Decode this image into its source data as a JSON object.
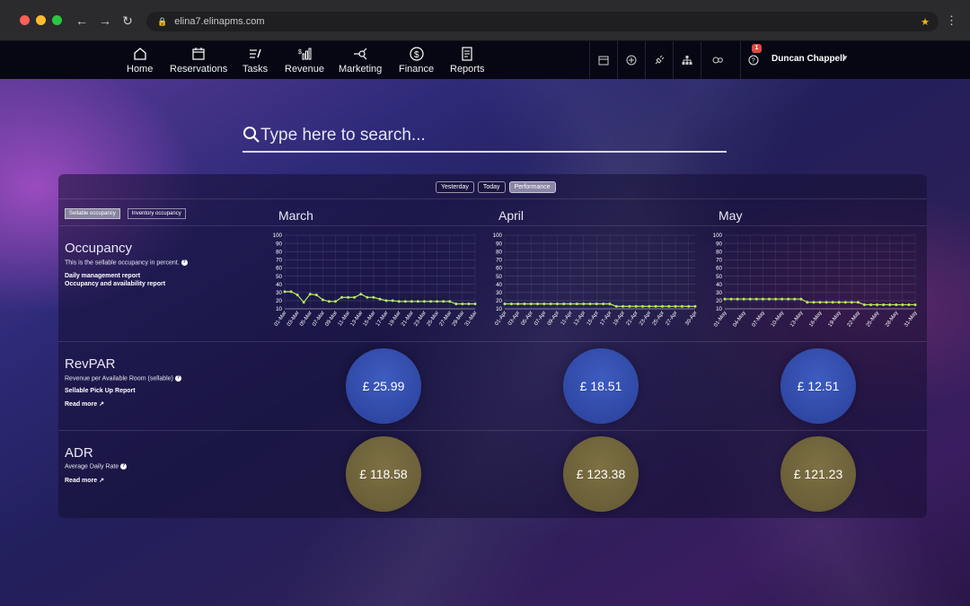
{
  "browser": {
    "url": "elina7.elinapms.com"
  },
  "nav": {
    "items": [
      {
        "label": "Home",
        "icon": "home-icon"
      },
      {
        "label": "Reservations",
        "icon": "calendar-icon"
      },
      {
        "label": "Tasks",
        "icon": "tasks-icon"
      },
      {
        "label": "Revenue",
        "icon": "revenue-icon"
      },
      {
        "label": "Marketing",
        "icon": "marketing-icon"
      },
      {
        "label": "Finance",
        "icon": "dollar-icon"
      },
      {
        "label": "Reports",
        "icon": "report-icon"
      }
    ],
    "notification_count": "1",
    "user_name": "Duncan Chappell"
  },
  "search": {
    "placeholder": "Type here to search..."
  },
  "tabs": {
    "period": [
      "Yesterday",
      "Today",
      "Performance"
    ],
    "active": "Performance",
    "occupancy_types": [
      "Sellable occupancy",
      "Inventory occupancy"
    ]
  },
  "months": [
    "March",
    "April",
    "May"
  ],
  "occupancy": {
    "title": "Occupancy",
    "description": "This is the sellable occupancy in percent.",
    "links": [
      "Daily management report",
      "Occupancy and availability report"
    ]
  },
  "revpar": {
    "title": "RevPAR",
    "description": "Revenue per Available Room (sellable)",
    "link": "Sellable Pick Up Report",
    "read_more": "Read more",
    "values": [
      "£ 25.99",
      "£ 18.51",
      "£ 12.51"
    ]
  },
  "adr": {
    "title": "ADR",
    "description": "Average Daily Rate",
    "read_more": "Read more",
    "values": [
      "£ 118.58",
      "£ 123.38",
      "£ 121.23"
    ]
  },
  "colors": {
    "line": "#b6e860",
    "revpar_circle": "#3451b0",
    "adr_circle": "#6d623a"
  },
  "chart_data": [
    {
      "type": "line",
      "x": [
        "01-Mar",
        "02-Mar",
        "03-Mar",
        "04-Mar",
        "05-Mar",
        "06-Mar",
        "07-Mar",
        "08-Mar",
        "09-Mar",
        "10-Mar",
        "11-Mar",
        "12-Mar",
        "13-Mar",
        "14-Mar",
        "15-Mar",
        "16-Mar",
        "17-Mar",
        "18-Mar",
        "19-Mar",
        "20-Mar",
        "21-Mar",
        "22-Mar",
        "23-Mar",
        "24-Mar",
        "25-Mar",
        "26-Mar",
        "27-Mar",
        "28-Mar",
        "29-Mar",
        "30-Mar",
        "31-Mar"
      ],
      "tick_labels": [
        "01-Mar",
        "03-Mar",
        "05-Mar",
        "07-Mar",
        "09-Mar",
        "11-Mar",
        "13-Mar",
        "15-Mar",
        "17-Mar",
        "19-Mar",
        "21-Mar",
        "23-Mar",
        "25-Mar",
        "27-Mar",
        "29-Mar",
        "31-Mar"
      ],
      "values": [
        31,
        31,
        27,
        18,
        28,
        27,
        21,
        19,
        19,
        24,
        24,
        24,
        28,
        24,
        24,
        22,
        20,
        20,
        19,
        19,
        19,
        19,
        19,
        19,
        19,
        19,
        19,
        16,
        16,
        16,
        16
      ],
      "ylim": [
        10,
        100
      ],
      "yticks": [
        10,
        20,
        30,
        40,
        50,
        60,
        70,
        80,
        90,
        100
      ],
      "grid": true
    },
    {
      "type": "line",
      "x": [
        "01-Apr",
        "02-Apr",
        "03-Apr",
        "04-Apr",
        "05-Apr",
        "06-Apr",
        "07-Apr",
        "08-Apr",
        "09-Apr",
        "10-Apr",
        "11-Apr",
        "12-Apr",
        "13-Apr",
        "14-Apr",
        "15-Apr",
        "16-Apr",
        "17-Apr",
        "18-Apr",
        "19-Apr",
        "20-Apr",
        "21-Apr",
        "22-Apr",
        "23-Apr",
        "24-Apr",
        "25-Apr",
        "26-Apr",
        "27-Apr",
        "28-Apr",
        "29-Apr",
        "30-Apr"
      ],
      "tick_labels": [
        "01-Apr",
        "03-Apr",
        "05-Apr",
        "07-Apr",
        "09-Apr",
        "11-Apr",
        "13-Apr",
        "15-Apr",
        "17-Apr",
        "19-Apr",
        "21-Apr",
        "23-Apr",
        "25-Apr",
        "27-Apr",
        "30-Apr"
      ],
      "values": [
        16,
        16,
        16,
        16,
        16,
        16,
        16,
        16,
        16,
        16,
        16,
        16,
        16,
        16,
        16,
        16,
        16,
        13,
        13,
        13,
        13,
        13,
        13,
        13,
        13,
        13,
        13,
        13,
        13,
        13
      ],
      "ylim": [
        10,
        100
      ],
      "yticks": [
        10,
        20,
        30,
        40,
        50,
        60,
        70,
        80,
        90,
        100
      ],
      "grid": true
    },
    {
      "type": "line",
      "x": [
        "01-May",
        "02-May",
        "03-May",
        "04-May",
        "05-May",
        "06-May",
        "07-May",
        "08-May",
        "09-May",
        "10-May",
        "11-May",
        "12-May",
        "13-May",
        "14-May",
        "15-May",
        "16-May",
        "17-May",
        "18-May",
        "19-May",
        "20-May",
        "21-May",
        "22-May",
        "23-May",
        "24-May",
        "25-May",
        "26-May",
        "27-May",
        "28-May",
        "29-May",
        "30-May",
        "31-May"
      ],
      "tick_labels": [
        "01-May",
        "04-May",
        "07-May",
        "10-May",
        "13-May",
        "16-May",
        "19-May",
        "22-May",
        "25-May",
        "28-May",
        "31-May"
      ],
      "values": [
        22,
        22,
        22,
        22,
        22,
        22,
        22,
        22,
        22,
        22,
        22,
        22,
        22,
        18,
        18,
        18,
        18,
        18,
        18,
        18,
        18,
        18,
        15,
        15,
        15,
        15,
        15,
        15,
        15,
        15,
        15
      ],
      "ylim": [
        10,
        100
      ],
      "yticks": [
        10,
        20,
        30,
        40,
        50,
        60,
        70,
        80,
        90,
        100
      ],
      "grid": true
    }
  ]
}
